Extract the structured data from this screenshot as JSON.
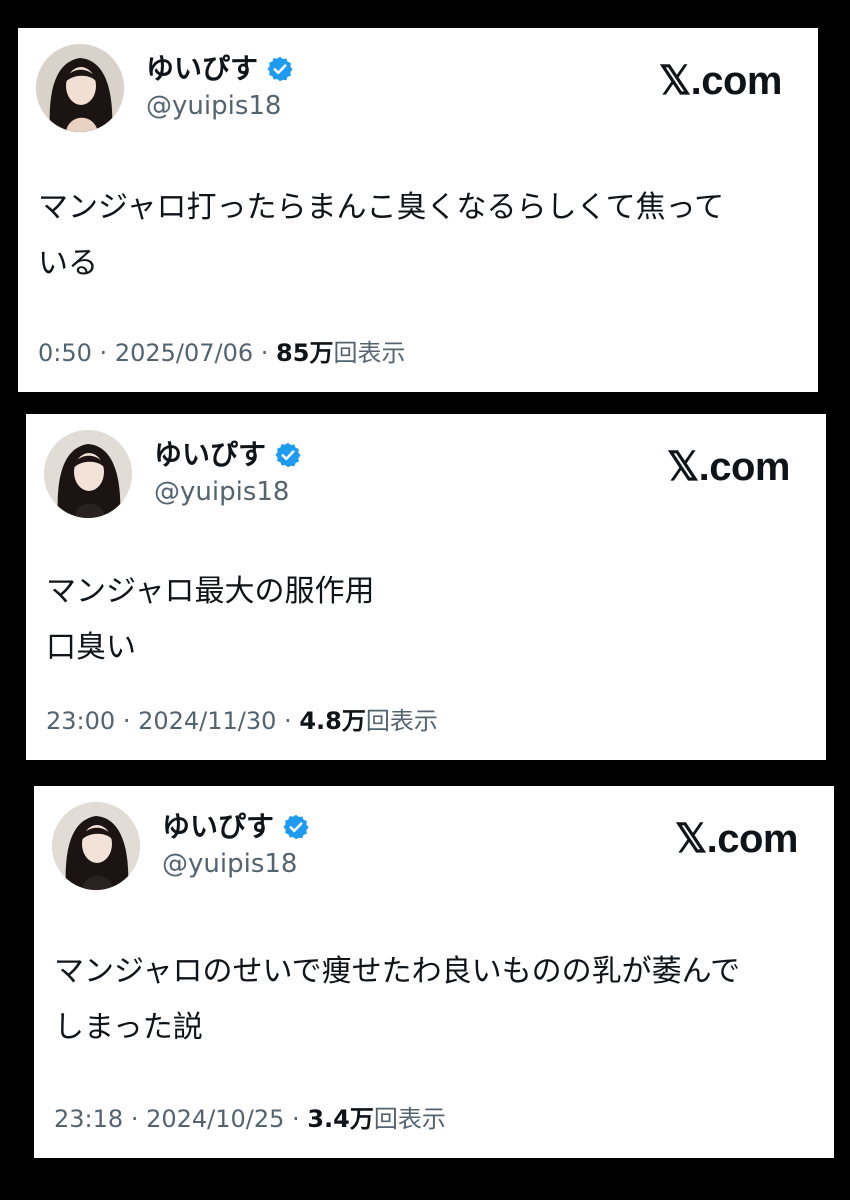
{
  "tweets": [
    {
      "display_name": "ゆいぴす",
      "handle": "@yuipis18",
      "site": "𝕏.com",
      "text": "マンジャロ打ったらまんこ臭くなるらしくて焦って\nいる",
      "time": "0:50",
      "date": "2025/07/06",
      "views_count": "85万",
      "views_label": "回表示"
    },
    {
      "display_name": "ゆいぴす",
      "handle": "@yuipis18",
      "site": "𝕏.com",
      "text": "マンジャロ最大の服作用\n口臭い",
      "time": "23:00",
      "date": "2024/11/30",
      "views_count": "4.8万",
      "views_label": "回表示"
    },
    {
      "display_name": "ゆいぴす",
      "handle": "@yuipis18",
      "site": "𝕏.com",
      "text": "マンジャロのせいで痩せたわ良いものの乳が萎んで\nしまった説",
      "time": "23:18",
      "date": "2024/10/25",
      "views_count": "3.4万",
      "views_label": "回表示"
    }
  ],
  "colors": {
    "background": "#000000",
    "card": "#ffffff",
    "text_primary": "#0f1419",
    "text_secondary": "#536471",
    "verified": "#1d9bf0"
  },
  "icons": {
    "verified": "verified-badge-icon",
    "avatar": "profile-photo"
  }
}
